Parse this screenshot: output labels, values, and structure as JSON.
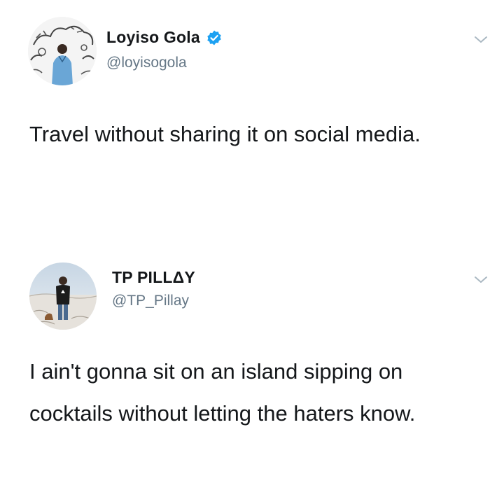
{
  "tweets": [
    {
      "display_name": "Loyiso Gola",
      "verified": true,
      "handle": "@loyisogola",
      "text": "Travel without sharing it on social media.",
      "avatar_icon": "profile-photo-icon",
      "menu_icon": "chevron-down-icon"
    },
    {
      "display_name": "TP PILLΔY",
      "verified": false,
      "handle": "@TP_Pillay",
      "text": "I ain't gonna sit on an island sipping on cocktails without letting the haters know.",
      "avatar_icon": "profile-photo-icon",
      "menu_icon": "chevron-down-icon"
    }
  ],
  "colors": {
    "text": "#14171a",
    "secondary_text": "#657786",
    "verified_blue": "#1da1f2",
    "chevron": "#aab8c2"
  }
}
